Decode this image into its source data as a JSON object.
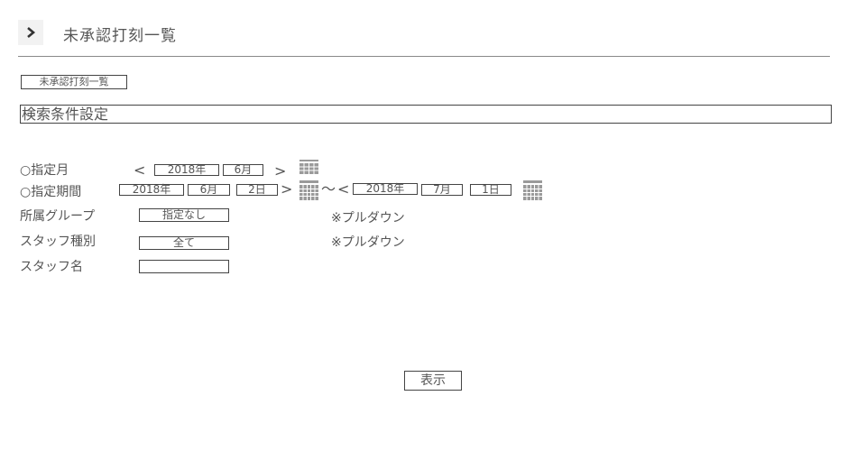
{
  "header": {
    "title": "未承認打刻一覧",
    "chevron_icon": "chevron-right-icon"
  },
  "tab": {
    "label": "未承認打刻一覧"
  },
  "section": {
    "title": "検索条件設定"
  },
  "month_filter": {
    "label": "○指定月",
    "prev": "<",
    "next": ">",
    "year": "2018年",
    "month": "6月",
    "calendar_icon": "calendar-icon"
  },
  "period_filter": {
    "label": "○指定期間",
    "from": {
      "year": "2018年",
      "month": "6月",
      "day": "2日",
      "next": ">"
    },
    "separator": "〜",
    "to": {
      "prev": "<",
      "year": "2018年",
      "month": "7月",
      "day": "1日"
    },
    "calendar_icon": "calendar-icon"
  },
  "group_filter": {
    "label": "所属グループ",
    "selected": "指定なし",
    "note": "※プルダウン"
  },
  "type_filter": {
    "label": "スタッフ種別",
    "selected": "全て",
    "note": "※プルダウン"
  },
  "name_filter": {
    "label": "スタッフ名",
    "value": ""
  },
  "actions": {
    "show_label": "表示"
  },
  "colors": {
    "text": "#555555",
    "border": "#444444",
    "rule": "#8a8a8a",
    "chevron_bg": "#f2f2f2"
  }
}
